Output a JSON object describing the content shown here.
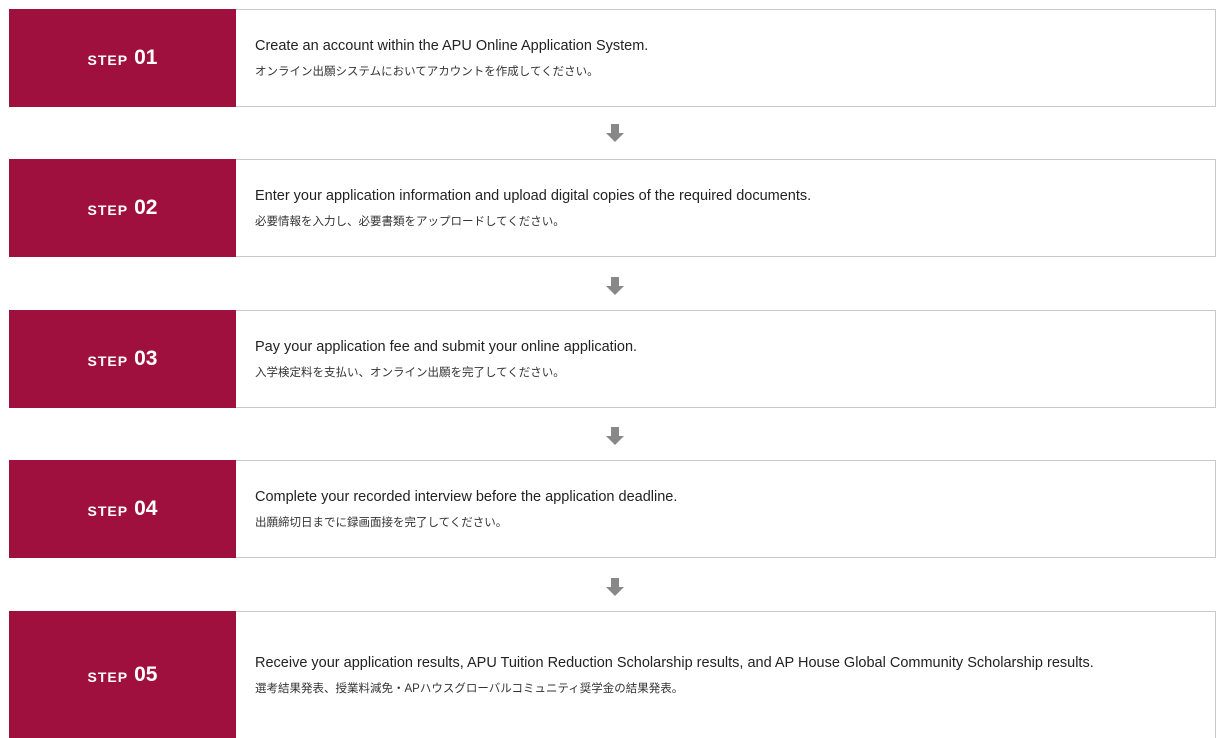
{
  "steps": [
    {
      "word": "STEP",
      "number": "01",
      "en": "Create an account within the APU Online Application System.",
      "ja": "オンライン出願システムにおいてアカウントを作成してください。"
    },
    {
      "word": "STEP",
      "number": "02",
      "en": "Enter your application information and upload digital copies of the required documents.",
      "ja": "必要情報を入力し、必要書類をアップロードしてください。"
    },
    {
      "word": "STEP",
      "number": "03",
      "en": "Pay your application fee and submit your online application.",
      "ja": "入学検定料を支払い、オンライン出願を完了してください。"
    },
    {
      "word": "STEP",
      "number": "04",
      "en": "Complete your recorded interview before the application deadline.",
      "ja": "出願締切日までに録画面接を完了してください。"
    },
    {
      "word": "STEP",
      "number": "05",
      "en": "Receive your application results, APU Tuition Reduction Scholarship results, and AP House Global Community Scholarship results.",
      "ja": "選考結果発表、授業料減免・APハウスグローバルコミュニティ奨学金の結果発表。"
    }
  ],
  "colors": {
    "step_label_bg": "#a0103f",
    "arrow": "#888888"
  },
  "icons": {
    "arrow": "arrow-down-icon"
  }
}
